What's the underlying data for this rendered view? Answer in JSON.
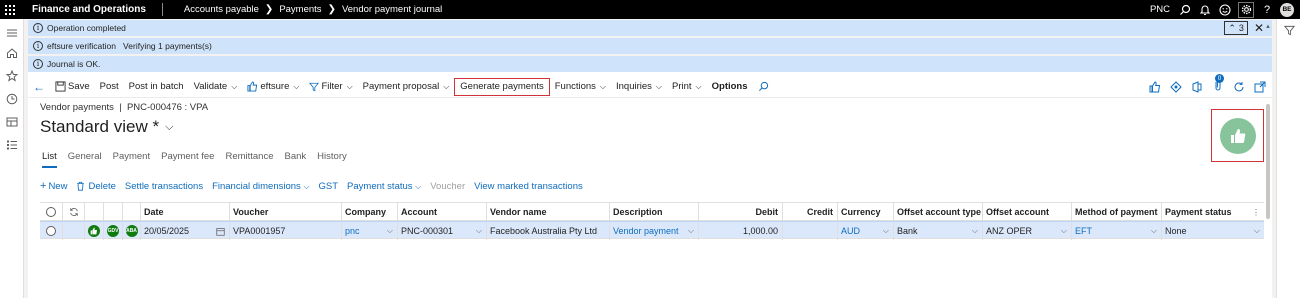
{
  "topbar": {
    "app_title": "Finance and Operations",
    "breadcrumb": [
      "Accounts payable",
      "Payments",
      "Vendor payment journal"
    ],
    "company": "PNC",
    "avatar_initials": "BE"
  },
  "messages": {
    "items": [
      {
        "text": "Operation completed"
      },
      {
        "text": "eftsure verification   Verifying 1 payments(s)"
      },
      {
        "text": "Journal is OK."
      }
    ],
    "count": "3"
  },
  "actions": {
    "save": "Save",
    "post": "Post",
    "post_in_batch": "Post in batch",
    "validate": "Validate",
    "eftsure": "eftsure",
    "filter": "Filter",
    "payment_proposal": "Payment proposal",
    "generate_payments": "Generate payments",
    "functions": "Functions",
    "inquiries": "Inquiries",
    "print": "Print",
    "options": "Options",
    "badge_count": "0"
  },
  "page": {
    "caption": "Vendor payments  |  PNC-000476 : VPA",
    "title": "Standard view *"
  },
  "tabs": [
    "List",
    "General",
    "Payment",
    "Payment fee",
    "Remittance",
    "Bank",
    "History"
  ],
  "gridbar": {
    "new": "New",
    "delete": "Delete",
    "settle": "Settle transactions",
    "financial_dimensions": "Financial dimensions",
    "gst": "GST",
    "payment_status": "Payment status",
    "voucher": "Voucher",
    "view_marked": "View marked transactions"
  },
  "table": {
    "headers": {
      "date": "Date",
      "voucher": "Voucher",
      "company": "Company",
      "account": "Account",
      "vendor_name": "Vendor name",
      "description": "Description",
      "debit": "Debit",
      "credit": "Credit",
      "currency": "Currency",
      "offset_type": "Offset account type",
      "offset_account": "Offset account",
      "method": "Method of payment",
      "status": "Payment status"
    },
    "row": {
      "badge1": "",
      "badge2": "GDV",
      "badge3": "ABA",
      "date": "20/05/2025",
      "voucher": "VPA0001957",
      "company": "pnc",
      "account": "PNC-000301",
      "vendor_name": "Facebook Australia Pty Ltd",
      "description": "Vendor payment",
      "debit": "1,000.00",
      "credit": "",
      "currency": "AUD",
      "offset_type": "Bank",
      "offset_account": "ANZ OPER",
      "method": "EFT",
      "status": "None"
    }
  },
  "colors": {
    "accent": "#0f6cbd",
    "message_bg": "#cfe4fa",
    "highlight_border": "#d13438",
    "success": "#107c10"
  }
}
